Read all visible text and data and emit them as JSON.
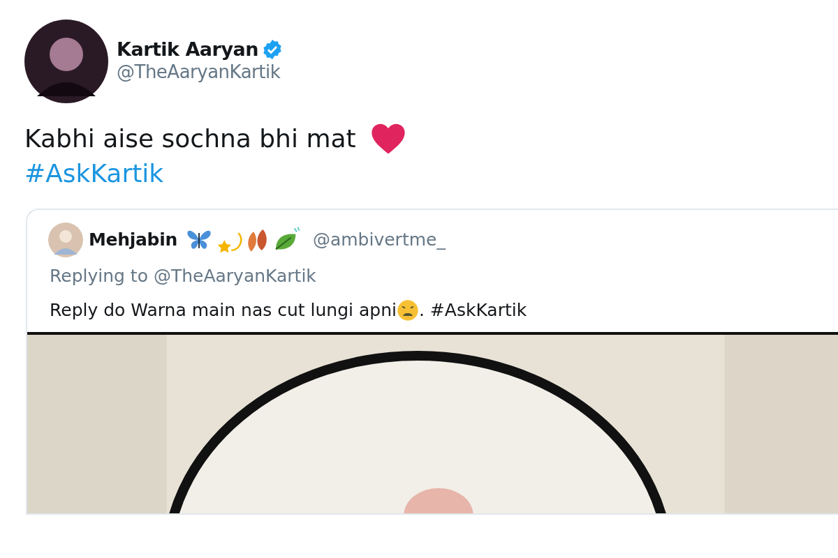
{
  "tweet": {
    "author": {
      "name": "Kartik Aaryan",
      "verified": true,
      "handle": "@TheAaryanKartik"
    },
    "text": "Kabhi aise sochna bhi mat",
    "hashtag": "#AskKartik",
    "quoted_tweet": {
      "author": {
        "name": "Mehjabin",
        "handle": "@ambivertme_"
      },
      "replying_to": "Replying to @TheAaryanKartik",
      "text_before_emoji": "Reply do Warna main nas cut lungi apni",
      "text_after_emoji": ". #AskKartik"
    }
  }
}
